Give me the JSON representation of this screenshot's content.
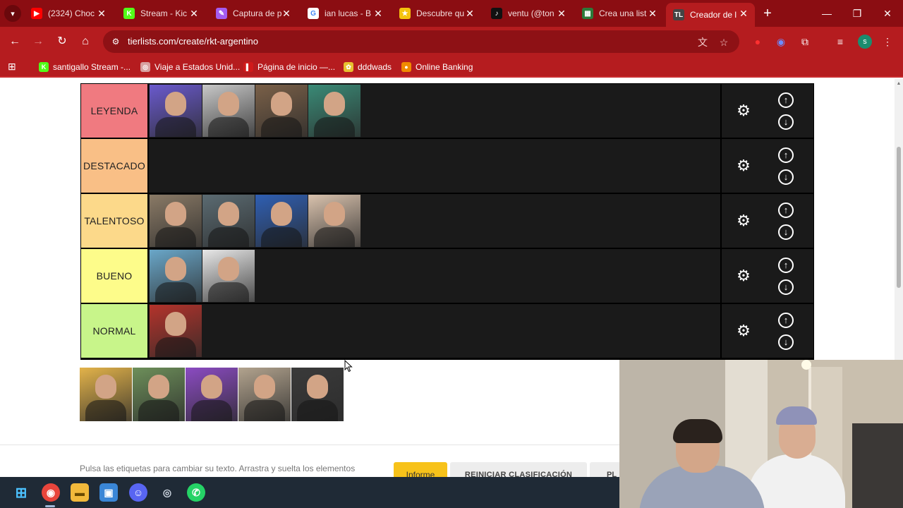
{
  "browser": {
    "tabs": [
      {
        "title": "(2324) Choc",
        "icon": "youtube-icon",
        "color": "#ff0000",
        "glyph": "▶"
      },
      {
        "title": "Stream - Kic",
        "icon": "kick-icon",
        "color": "#53fc18",
        "glyph": "K"
      },
      {
        "title": "Captura de p",
        "icon": "pen-icon",
        "color": "#a45cf0",
        "glyph": "✎"
      },
      {
        "title": "ian lucas - B",
        "icon": "google-icon",
        "color": "#ffffff",
        "glyph": "G"
      },
      {
        "title": "Descubre qu",
        "icon": "star-icon",
        "color": "#f4c20d",
        "glyph": "★"
      },
      {
        "title": "ventu (@ton",
        "icon": "tiktok-icon",
        "color": "#111111",
        "glyph": "♪"
      },
      {
        "title": "Crea una list",
        "icon": "list-icon",
        "color": "#2d7a3a",
        "glyph": "▦"
      },
      {
        "title": "Creador de l",
        "icon": "tierlist-icon",
        "color": "#444444",
        "glyph": "TL"
      }
    ],
    "url": "tierlists.com/create/rkt-argentino",
    "profile_initial": "s",
    "bookmarks": [
      {
        "label": "santigallo Stream -...",
        "icon": "kick-icon",
        "color": "#53fc18",
        "glyph": "K"
      },
      {
        "label": "Viaje a Estados Unid...",
        "icon": "globe-icon",
        "color": "#d8a0a0",
        "glyph": "◎"
      },
      {
        "label": "Página de inicio —...",
        "icon": "bookmark-icon",
        "color": "#d01a1a",
        "glyph": "▌"
      },
      {
        "label": "dddwads",
        "icon": "paint-icon",
        "color": "#e8c030",
        "glyph": "✿"
      },
      {
        "label": "Online Banking",
        "icon": "bank-icon",
        "color": "#f08a00",
        "glyph": "●"
      }
    ]
  },
  "tiers": [
    {
      "label": "LEYENDA",
      "color": "#f07a80",
      "items": [
        "#6a5acd",
        "#c8c8c8",
        "#7a6048",
        "#3a8a76"
      ]
    },
    {
      "label": "DESTACADO",
      "color": "#f9bf86",
      "items": []
    },
    {
      "label": "TALENTOSO",
      "color": "#fcd98a",
      "items": [
        "#8a7a66",
        "#5b6b72",
        "#2f5fb3",
        "#d9c2ad"
      ]
    },
    {
      "label": "BUENO",
      "color": "#fdfc8a",
      "items": [
        "#6aa7c9",
        "#e8e8e8"
      ]
    },
    {
      "label": "NORMAL",
      "color": "#c8f58a",
      "items": [
        "#b4332b"
      ]
    }
  ],
  "pool_items": [
    "#e3b34a",
    "#6d8f5a",
    "#8b4bc2",
    "#b2a38e",
    "#3a3a3a"
  ],
  "page": {
    "help_text": "Pulsa las etiquetas para cambiar su texto. Arrastra y suelta los elementos",
    "save_label": "Informe",
    "reset_label": "REINICIAR CLASIFICACIÓN",
    "more_label": "PL"
  },
  "colors": {
    "browser_dark": "#8b0d12",
    "browser_main": "#b51c1f",
    "save_button": "#f7c21a"
  }
}
